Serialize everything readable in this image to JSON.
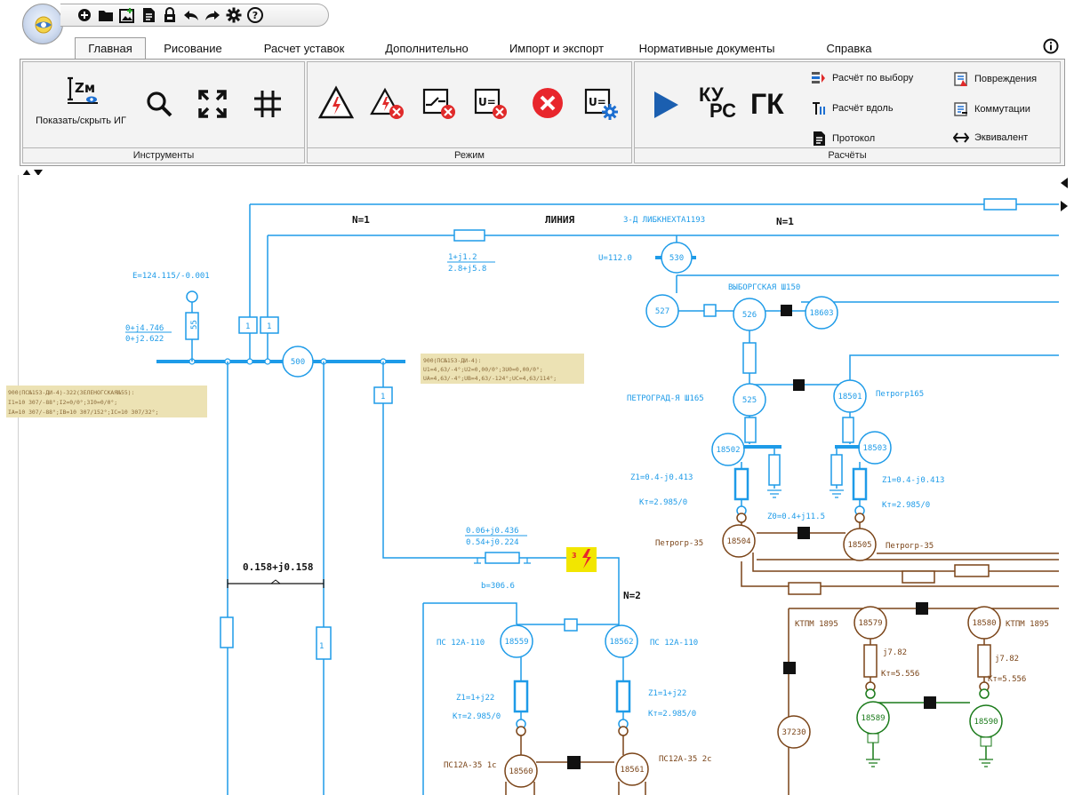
{
  "menu": {
    "tabs": [
      "Главная",
      "Рисование",
      "Расчет уставок",
      "Дополнительно",
      "Импорт и экспорт",
      "Нормативные документы",
      "Справка"
    ],
    "active_index": 0
  },
  "ribbon": {
    "tools": {
      "label": "Инструменты",
      "show_ig": "Показать/скрыть ИГ",
      "zm_icon_text": "Zм"
    },
    "mode": {
      "label": "Режим"
    },
    "calc": {
      "label": "Расчёты",
      "kurs": [
        "КУ",
        "РС"
      ],
      "gk": "ГК",
      "items": [
        "Расчёт по выбору",
        "Расчёт вдоль",
        "Протокол",
        "Повреждения",
        "Коммутации",
        "Эквивалент"
      ]
    }
  },
  "colors": {
    "blue": "#1e9be8",
    "brown": "#7a4418",
    "green": "#1a7a1a",
    "highlight": "#ece2b4",
    "fault": "#f2e600",
    "accent": "#1b5fb0"
  },
  "diagram": {
    "labels": [
      "N=1",
      "ЛИНИЯ",
      "3-Д ЛИБКНЕХТА1193",
      "N=1",
      "1+j1.2",
      "2.8+j5.8",
      "U=112.0",
      "E=124.115/-0.001",
      "0+j4.746",
      "0+j2.622",
      "ВЫБОРГСКАЯ Ш150",
      "ПЕТРОГРАД-Я Ш165",
      "Петрогр165",
      "Z1=0.4-j0.413",
      "Кт=2.985/0",
      "Z1=0.4-j0.413",
      "Кт=2.985/0",
      "Z0=0.4+j11.5",
      "Петрогр-35",
      "Петрогр-35",
      "0.06+j0.436",
      "0.54+j0.224",
      "b=306.6",
      "N=2",
      "0.158+j0.158",
      "ПС 12А-110",
      "ПС 12А-110",
      "Z1=1+j22",
      "Кт=2.985/0",
      "Z1=1+j22",
      "Кт=2.985/0",
      "ПС12А-35 1с",
      "ПС12А-35 2с",
      "КТПМ 1895",
      "КТПМ 1895",
      "j7.82",
      "Кт=5.556",
      "j7.82",
      "Кт=5.556"
    ],
    "nodes": [
      "530",
      "500",
      "527",
      "526",
      "18603",
      "525",
      "18501",
      "18502",
      "18503",
      "18504",
      "18505",
      "18559",
      "18562",
      "18560",
      "18561",
      "18579",
      "18580",
      "18589",
      "18590",
      "37230"
    ],
    "annotations": [
      [
        "900(ПС№153-ДИ-4):",
        "U1=4,63/-4°;U2=0,00/0°;3U0=0,00/0°;",
        "UA=4,63/-4°;UB=4,63/-124°;UC=4,63/114°;"
      ],
      [
        "900(ПС№153-ДИ-4)-322(ЗЕЛЕНОГСКАЯ№55):",
        "I1=10 307/-88°;I2=0/0°;3I0=0/0°;",
        "IA=10 307/-88°;IB=10 307/152°;IC=10 307/32°;"
      ]
    ],
    "small": [
      "1",
      "1",
      "1",
      "55"
    ]
  }
}
